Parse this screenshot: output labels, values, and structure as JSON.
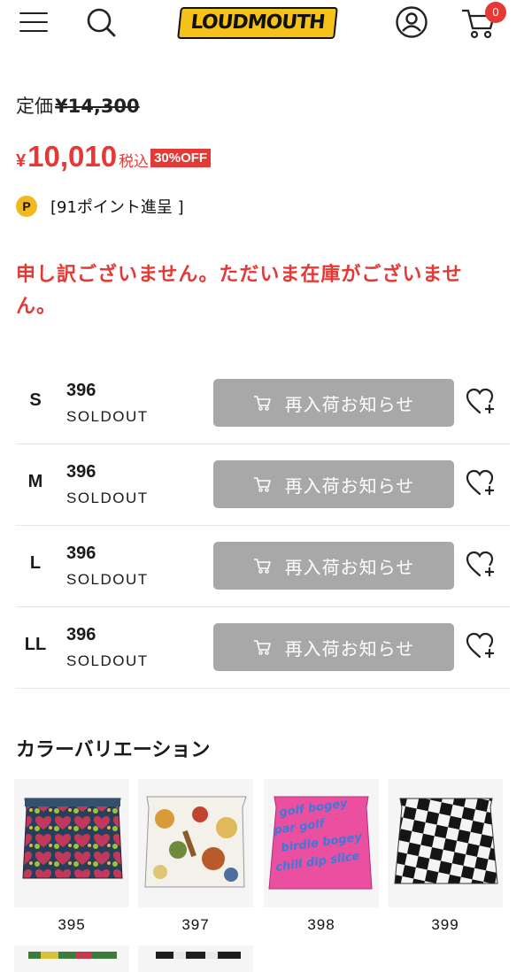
{
  "header": {
    "logo_text": "LOUDMOUTH",
    "cart_count": "0",
    "icons": [
      "menu-icon",
      "search-icon",
      "account-icon",
      "cart-icon"
    ]
  },
  "pricing": {
    "list_label": "定価",
    "list_price": "¥14,300",
    "sale_currency": "¥",
    "sale_amount": "10,010",
    "tax_label": "税込",
    "discount_badge": "30%OFF",
    "points_icon_letter": "P",
    "points_text": "[91ポイント進呈 ]"
  },
  "stock_message": "申し訳ございません。ただいま在庫がございません。",
  "sizes": [
    {
      "size": "S",
      "code": "396",
      "status": "SOLDOUT",
      "button": "再入荷お知らせ"
    },
    {
      "size": "M",
      "code": "396",
      "status": "SOLDOUT",
      "button": "再入荷お知らせ"
    },
    {
      "size": "L",
      "code": "396",
      "status": "SOLDOUT",
      "button": "再入荷お知らせ"
    },
    {
      "size": "LL",
      "code": "396",
      "status": "SOLDOUT",
      "button": "再入荷お知らせ"
    }
  ],
  "color_variation": {
    "title": "カラーバリエーション",
    "items": [
      {
        "code": "395",
        "pattern": "hearts-mosaic"
      },
      {
        "code": "397",
        "pattern": "food-illustration"
      },
      {
        "code": "398",
        "pattern": "pink-text-print"
      },
      {
        "code": "399",
        "pattern": "black-white-checker"
      }
    ]
  },
  "colors": {
    "accent_red": "#e53935",
    "button_gray": "#a8a8a8",
    "logo_yellow": "#f4c21a",
    "points_gold": "#f2b91f"
  }
}
